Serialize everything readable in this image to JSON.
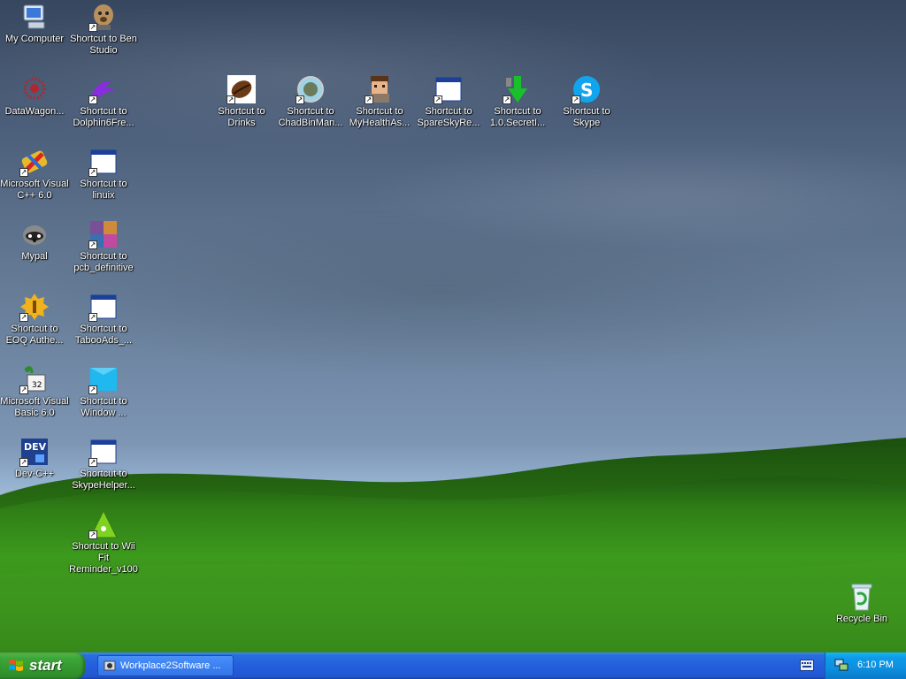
{
  "desktop": {
    "icons": [
      {
        "id": "my-computer",
        "label": "My Computer",
        "icon": "computer-icon",
        "shortcut": false
      },
      {
        "id": "ben-studio",
        "label": "Shortcut to Ben Studio",
        "icon": "dog-icon",
        "shortcut": true
      },
      {
        "id": "datawagon",
        "label": "DataWagon...",
        "icon": "datawagon-icon",
        "shortcut": false
      },
      {
        "id": "dolphin6",
        "label": "Shortcut to Dolphin6Fre...",
        "icon": "dolphin-icon",
        "shortcut": true
      },
      {
        "id": "drinks",
        "label": "Shortcut to Drinks",
        "icon": "coffee-bean-icon",
        "shortcut": true
      },
      {
        "id": "chadbinman",
        "label": "Shortcut to ChadBinMan...",
        "icon": "globe-icon",
        "shortcut": true
      },
      {
        "id": "myhealthas",
        "label": "Shortcut to MyHealthAs...",
        "icon": "avatar-icon",
        "shortcut": true
      },
      {
        "id": "spareskyre",
        "label": "Shortcut to SpareSkyRe...",
        "icon": "window-icon",
        "shortcut": true
      },
      {
        "id": "secreti",
        "label": "Shortcut to 1.0.SecretI...",
        "icon": "download-arrow-icon",
        "shortcut": true
      },
      {
        "id": "skype",
        "label": "Shortcut to Skype",
        "icon": "skype-icon",
        "shortcut": true
      },
      {
        "id": "msvc6",
        "label": "Microsoft Visual C++ 6.0",
        "icon": "visual-cpp-icon",
        "shortcut": true
      },
      {
        "id": "linuix",
        "label": "Shortcut to linuix",
        "icon": "window-icon",
        "shortcut": true
      },
      {
        "id": "mypal",
        "label": "Mypal",
        "icon": "raccoon-icon",
        "shortcut": false
      },
      {
        "id": "pcb",
        "label": "Shortcut to pcb_definitive",
        "icon": "photo-collage-icon",
        "shortcut": true
      },
      {
        "id": "eoq",
        "label": "Shortcut to EOQ Authe...",
        "icon": "key-badge-icon",
        "shortcut": true
      },
      {
        "id": "tabooads",
        "label": "Shortcut to TabooAds_...",
        "icon": "window-icon",
        "shortcut": true
      },
      {
        "id": "msvb6",
        "label": "Microsoft Visual Basic 6.0",
        "icon": "visual-basic-icon",
        "shortcut": true
      },
      {
        "id": "window",
        "label": "Shortcut to Window ...",
        "icon": "folder-blue-icon",
        "shortcut": true
      },
      {
        "id": "devcpp",
        "label": "Dev-C++",
        "icon": "dev-cpp-icon",
        "shortcut": true
      },
      {
        "id": "skypehelper",
        "label": "Shortcut to SkypeHelper...",
        "icon": "window-icon",
        "shortcut": true
      },
      {
        "id": "wiifit",
        "label": "Shortcut to Wii Fit Reminder_v100",
        "icon": "triangle-green-icon",
        "shortcut": true
      },
      {
        "id": "recycle",
        "label": "Recycle Bin",
        "icon": "recycle-bin-icon",
        "shortcut": false
      }
    ]
  },
  "taskbar": {
    "start_label": "start",
    "task_label": "Workplace2Software ...",
    "clock": "6:10 PM"
  }
}
